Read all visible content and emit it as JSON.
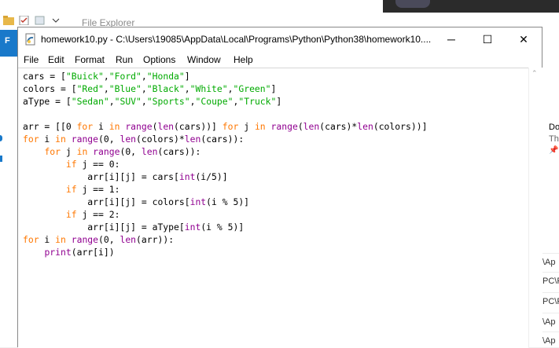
{
  "explorer": {
    "title": "File Explorer",
    "ribbon_tab": "F",
    "right_lines": [
      "Do",
      "Th",
      "\\Ap",
      "PC\\F",
      "PC\\F",
      "\\Ap",
      "\\Ap"
    ]
  },
  "window": {
    "title": "homework10.py - C:\\Users\\19085\\AppData\\Local\\Programs\\Python\\Python38\\homework10....",
    "minimize": "─",
    "maximize": "☐",
    "close": "✕"
  },
  "menu": [
    "File",
    "Edit",
    "Format",
    "Run",
    "Options",
    "Window",
    "Help"
  ],
  "code_lines": [
    [
      [
        "n",
        "cars = ["
      ],
      [
        "s",
        "\"Buick\""
      ],
      [
        "n",
        ","
      ],
      [
        "s",
        "\"Ford\""
      ],
      [
        "n",
        ","
      ],
      [
        "s",
        "\"Honda\""
      ],
      [
        "n",
        "]"
      ]
    ],
    [
      [
        "n",
        "colors = ["
      ],
      [
        "s",
        "\"Red\""
      ],
      [
        "n",
        ","
      ],
      [
        "s",
        "\"Blue\""
      ],
      [
        "n",
        ","
      ],
      [
        "s",
        "\"Black\""
      ],
      [
        "n",
        ","
      ],
      [
        "s",
        "\"White\""
      ],
      [
        "n",
        ","
      ],
      [
        "s",
        "\"Green\""
      ],
      [
        "n",
        "]"
      ]
    ],
    [
      [
        "n",
        "aType = ["
      ],
      [
        "s",
        "\"Sedan\""
      ],
      [
        "n",
        ","
      ],
      [
        "s",
        "\"SUV\""
      ],
      [
        "n",
        ","
      ],
      [
        "s",
        "\"Sports\""
      ],
      [
        "n",
        ","
      ],
      [
        "s",
        "\"Coupe\""
      ],
      [
        "n",
        ","
      ],
      [
        "s",
        "\"Truck\""
      ],
      [
        "n",
        "]"
      ]
    ],
    [],
    [
      [
        "n",
        "arr = [[0 "
      ],
      [
        "k",
        "for"
      ],
      [
        "n",
        " i "
      ],
      [
        "k",
        "in"
      ],
      [
        "n",
        " "
      ],
      [
        "b",
        "range"
      ],
      [
        "n",
        "("
      ],
      [
        "b",
        "len"
      ],
      [
        "n",
        "(cars))] "
      ],
      [
        "k",
        "for"
      ],
      [
        "n",
        " j "
      ],
      [
        "k",
        "in"
      ],
      [
        "n",
        " "
      ],
      [
        "b",
        "range"
      ],
      [
        "n",
        "("
      ],
      [
        "b",
        "len"
      ],
      [
        "n",
        "(cars)*"
      ],
      [
        "b",
        "len"
      ],
      [
        "n",
        "(colors))]"
      ]
    ],
    [
      [
        "k",
        "for"
      ],
      [
        "n",
        " i "
      ],
      [
        "k",
        "in"
      ],
      [
        "n",
        " "
      ],
      [
        "b",
        "range"
      ],
      [
        "n",
        "(0, "
      ],
      [
        "b",
        "len"
      ],
      [
        "n",
        "(colors)*"
      ],
      [
        "b",
        "len"
      ],
      [
        "n",
        "(cars)):"
      ]
    ],
    [
      [
        "n",
        "    "
      ],
      [
        "k",
        "for"
      ],
      [
        "n",
        " j "
      ],
      [
        "k",
        "in"
      ],
      [
        "n",
        " "
      ],
      [
        "b",
        "range"
      ],
      [
        "n",
        "(0, "
      ],
      [
        "b",
        "len"
      ],
      [
        "n",
        "(cars)):"
      ]
    ],
    [
      [
        "n",
        "        "
      ],
      [
        "k",
        "if"
      ],
      [
        "n",
        " j == 0:"
      ]
    ],
    [
      [
        "n",
        "            arr[i][j] = cars["
      ],
      [
        "b",
        "int"
      ],
      [
        "n",
        "(i/5)]"
      ]
    ],
    [
      [
        "n",
        "        "
      ],
      [
        "k",
        "if"
      ],
      [
        "n",
        " j == 1:"
      ]
    ],
    [
      [
        "n",
        "            arr[i][j] = colors["
      ],
      [
        "b",
        "int"
      ],
      [
        "n",
        "(i % 5)]"
      ]
    ],
    [
      [
        "n",
        "        "
      ],
      [
        "k",
        "if"
      ],
      [
        "n",
        " j == 2:"
      ]
    ],
    [
      [
        "n",
        "            arr[i][j] = aType["
      ],
      [
        "b",
        "int"
      ],
      [
        "n",
        "(i % 5)]"
      ]
    ],
    [
      [
        "k",
        "for"
      ],
      [
        "n",
        " i "
      ],
      [
        "k",
        "in"
      ],
      [
        "n",
        " "
      ],
      [
        "b",
        "range"
      ],
      [
        "n",
        "(0, "
      ],
      [
        "b",
        "len"
      ],
      [
        "n",
        "(arr)):"
      ]
    ],
    [
      [
        "n",
        "    "
      ],
      [
        "b",
        "print"
      ],
      [
        "n",
        "(arr[i])"
      ]
    ]
  ],
  "colors": {
    "keyword": "#ff7700",
    "builtin": "#900090",
    "string": "#00aa00",
    "text": "#000000",
    "explorer_accent": "#1979ca"
  }
}
